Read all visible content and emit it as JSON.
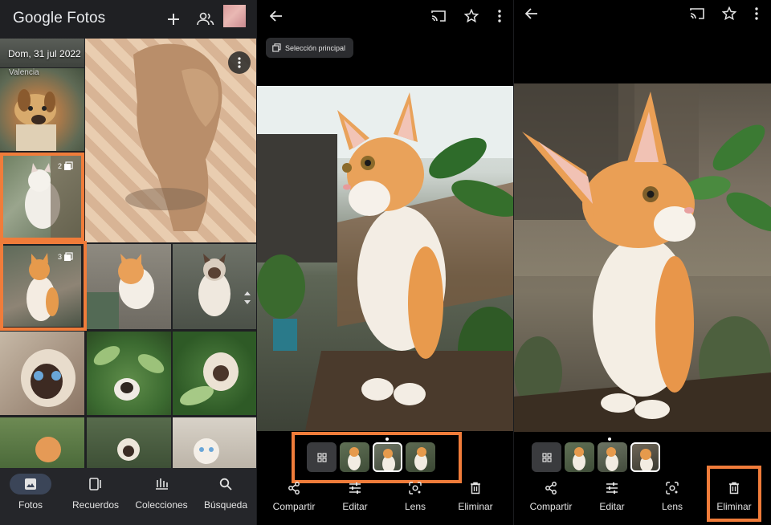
{
  "panel1": {
    "app_title_bold": "Google",
    "app_title_rest": " Fotos",
    "header_icons": [
      "plus-icon",
      "share-people-icon"
    ],
    "date_heading": "Dom, 31 jul 2022",
    "location": "Valencia",
    "stack_count_1": "2",
    "stack_count_2": "3",
    "nav": [
      {
        "label": "Fotos",
        "icon": "photo-icon",
        "active": true
      },
      {
        "label": "Recuerdos",
        "icon": "memories-icon",
        "active": false
      },
      {
        "label": "Colecciones",
        "icon": "collections-icon",
        "active": false
      },
      {
        "label": "Búsqueda",
        "icon": "search-icon",
        "active": false
      }
    ]
  },
  "panel2": {
    "chip_label": "Selección principal",
    "actions": [
      {
        "label": "Compartir",
        "icon": "share-icon"
      },
      {
        "label": "Editar",
        "icon": "edit-sliders-icon"
      },
      {
        "label": "Lens",
        "icon": "lens-icon"
      },
      {
        "label": "Eliminar",
        "icon": "trash-icon"
      }
    ]
  },
  "panel3": {
    "actions": [
      {
        "label": "Compartir",
        "icon": "share-icon"
      },
      {
        "label": "Editar",
        "icon": "edit-sliders-icon"
      },
      {
        "label": "Lens",
        "icon": "lens-icon"
      },
      {
        "label": "Eliminar",
        "icon": "trash-icon"
      }
    ]
  },
  "colors": {
    "highlight": "#f07c3a",
    "active_nav_pill": "#3b4558",
    "background_dark": "#1f2023"
  }
}
